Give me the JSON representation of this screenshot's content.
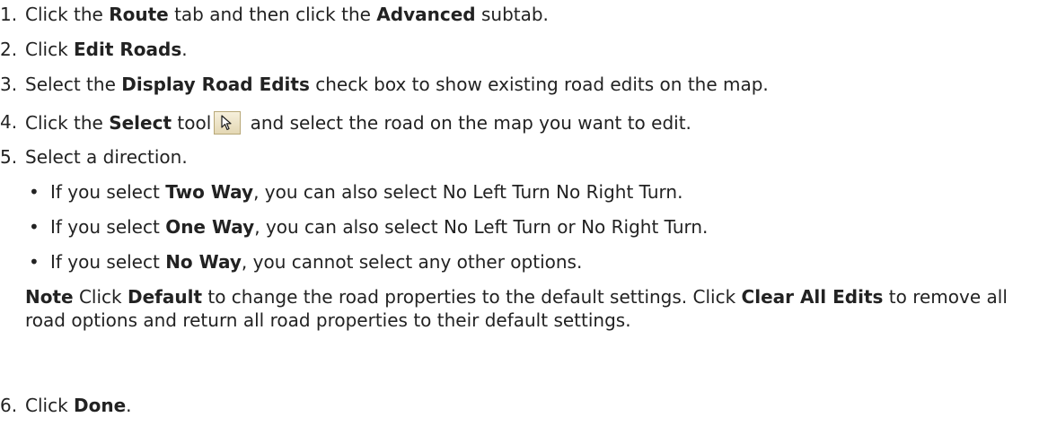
{
  "steps": [
    {
      "num": "1.",
      "parts": [
        "Click the ",
        "Route",
        " tab and then click the ",
        "Advanced",
        " subtab."
      ]
    },
    {
      "num": "2.",
      "parts": [
        "Click ",
        "Edit Roads",
        "."
      ]
    },
    {
      "num": "3.",
      "parts": [
        "Select the ",
        "Display Road Edits",
        " check box to show existing road edits on the map."
      ]
    },
    {
      "num": "4.",
      "parts": [
        "Click the ",
        "Select",
        " tool",
        " and select the road on the map you want to edit."
      ]
    },
    {
      "num": "5.",
      "parts": [
        "Select a direction."
      ]
    },
    {
      "num": "6.",
      "parts": [
        "Click ",
        "Done",
        "."
      ]
    }
  ],
  "bullets": [
    {
      "mark": "•",
      "parts": [
        "If you select ",
        "Two Way",
        ", you can also select No Left Turn No Right Turn."
      ]
    },
    {
      "mark": "•",
      "parts": [
        "If you select ",
        "One Way",
        ", you can also select No Left Turn or No Right Turn."
      ]
    },
    {
      "mark": "•",
      "parts": [
        "If you select ",
        "No Way",
        ", you cannot select any other options."
      ]
    }
  ],
  "note": {
    "label": "Note",
    "parts": [
      "  Click ",
      "Default",
      " to change the road properties to the default settings. Click ",
      "Clear All Edits",
      " to remove all road options and return all road properties to their default settings."
    ]
  },
  "icons": {
    "select_tool": "arrow-cursor-icon"
  },
  "colors": {
    "text": "#222222",
    "icon_bg": "#e4d8b4"
  }
}
